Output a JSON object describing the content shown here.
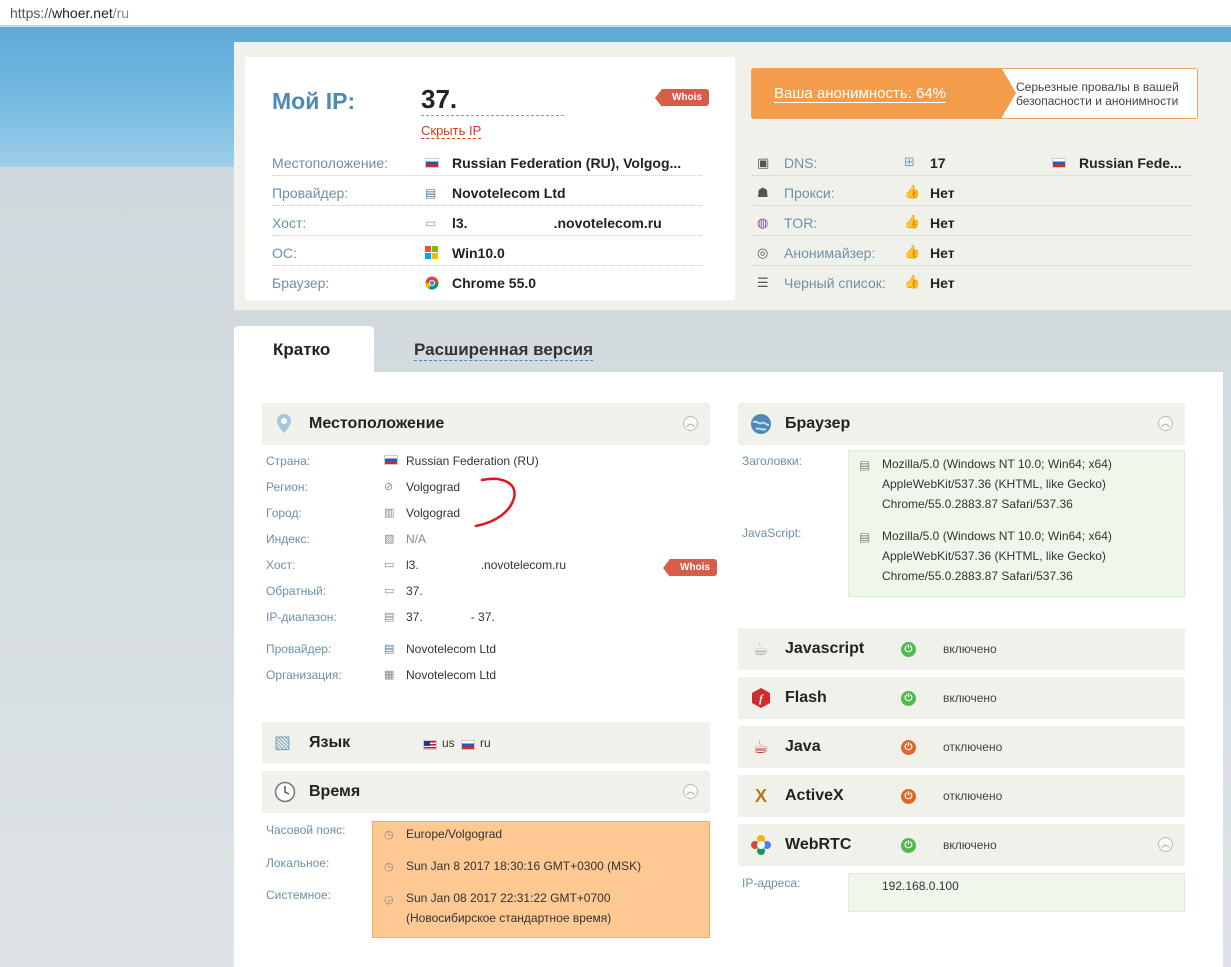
{
  "browser": {
    "url_scheme": "https://",
    "url_host": "whoer.net",
    "url_path": "/ru"
  },
  "ip": {
    "label": "Мой IP:",
    "value": "37.",
    "hide_label": "Скрыть IP",
    "whois": "Whois"
  },
  "info": [
    {
      "label": "Местоположение:",
      "value": "Russian Federation (RU), Volgog..."
    },
    {
      "label": "Провайдер:",
      "value": "Novotelecom Ltd"
    },
    {
      "label": "Хост:",
      "value_prefix": "l3.",
      "value_suffix": ".novotelecom.ru"
    },
    {
      "label": "ОС:",
      "value": "Win10.0"
    },
    {
      "label": "Браузер:",
      "value": "Chrome 55.0"
    }
  ],
  "anonymity": {
    "label": "Ваша анонимность: 64%",
    "note": "Серьезные провалы в вашей безопасности и анонимности"
  },
  "security": [
    {
      "label": "DNS:",
      "value": "17",
      "extra": "Russian Fede..."
    },
    {
      "label": "Прокси:",
      "value": "Нет"
    },
    {
      "label": "TOR:",
      "value": "Нет"
    },
    {
      "label": "Анонимайзер:",
      "value": "Нет"
    },
    {
      "label": "Черный список:",
      "value": "Нет"
    }
  ],
  "tabs": {
    "active": "Кратко",
    "other": "Расширенная версия"
  },
  "location": {
    "title": "Местоположение",
    "rows": [
      {
        "k": "Страна:",
        "v": "Russian Federation (RU)"
      },
      {
        "k": "Регион:",
        "v": "Volgograd"
      },
      {
        "k": "Город:",
        "v": "Volgograd"
      },
      {
        "k": "Индекс:",
        "v": "N/A"
      },
      {
        "k": "Хост:",
        "v": "l3.",
        "v2": ".novotelecom.ru"
      },
      {
        "k": "Обратный:",
        "v": "37."
      },
      {
        "k": "IP-диапазон:",
        "v": "37.",
        "v2": "- 37."
      },
      {
        "k": "Провайдер:",
        "v": "Novotelecom Ltd"
      },
      {
        "k": "Организация:",
        "v": "Novotelecom Ltd"
      }
    ],
    "whois": "Whois"
  },
  "language": {
    "title": "Язык",
    "lang1": "us",
    "lang2": "ru"
  },
  "time": {
    "title": "Время",
    "rows": [
      {
        "k": "Часовой пояс:",
        "v": "Europe/Volgograd"
      },
      {
        "k": "Локальное:",
        "v": "Sun Jan 8 2017 18:30:16 GMT+0300 (MSK)"
      },
      {
        "k": "Системное:",
        "v": "Sun Jan 08 2017 22:31:22 GMT+0700",
        "v2": "(Новосибирское стандартное время)"
      }
    ]
  },
  "browser_section": {
    "title": "Браузер",
    "headers_label": "Заголовки:",
    "headers_lines": [
      "Mozilla/5.0 (Windows NT 10.0; Win64; x64)",
      "AppleWebKit/537.36 (KHTML, like Gecko)",
      "Chrome/55.0.2883.87 Safari/537.36"
    ],
    "js_label": "JavaScript:",
    "js_lines": [
      "Mozilla/5.0 (Windows NT 10.0; Win64; x64)",
      "AppleWebKit/537.36 (KHTML, like Gecko)",
      "Chrome/55.0.2883.87 Safari/537.36"
    ]
  },
  "plugins": [
    {
      "name": "Javascript",
      "status": "включено",
      "state": "on"
    },
    {
      "name": "Flash",
      "status": "включено",
      "state": "on"
    },
    {
      "name": "Java",
      "status": "отключено",
      "state": "off"
    },
    {
      "name": "ActiveX",
      "status": "отключено",
      "state": "off"
    },
    {
      "name": "WebRTC",
      "status": "включено",
      "state": "on"
    }
  ],
  "webrtc": {
    "label": "IP-адреса:",
    "value": "192.168.0.100"
  },
  "colors": {
    "accent": "#f39c4b",
    "link": "#4c8ab5",
    "label": "#6d8fa8",
    "on": "#52b84f",
    "off": "#e0682c"
  }
}
